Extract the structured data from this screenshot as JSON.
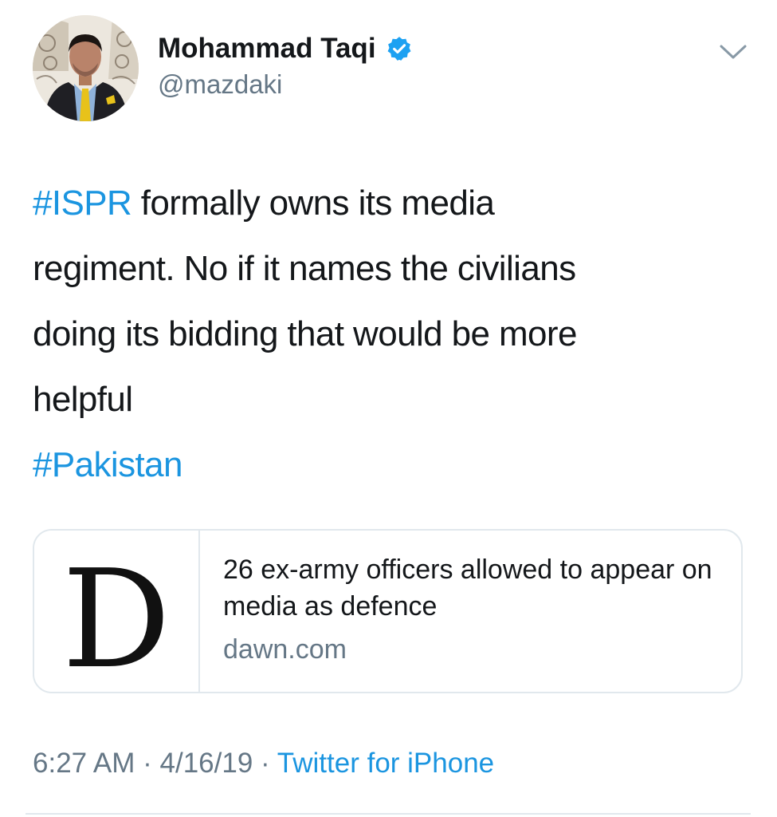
{
  "colors": {
    "link": "#1b95e0",
    "text": "#14171a",
    "secondary": "#657786",
    "border": "#e1e8ed"
  },
  "author": {
    "display_name": "Mohammad Taqi",
    "handle": "@mazdaki",
    "avatar_icon": "profile-photo",
    "verified_icon": "verified-badge-icon"
  },
  "menu_icon": "chevron-down-icon",
  "tweet": {
    "hashtag_ispr": "#ISPR",
    "text_line1_rest": " formally owns its media",
    "text_line2": "regiment. No if it names the civilians",
    "text_line3": "doing its bidding that would be more",
    "text_line4": "helpful",
    "hashtag_pakistan": "#Pakistan"
  },
  "card": {
    "logo_letter": "D",
    "title": "26 ex-army officers allowed to appear on media as defence",
    "domain": "dawn.com"
  },
  "meta": {
    "time": "6:27 AM",
    "separator": " · ",
    "date": "4/16/19",
    "source": "Twitter for iPhone"
  }
}
